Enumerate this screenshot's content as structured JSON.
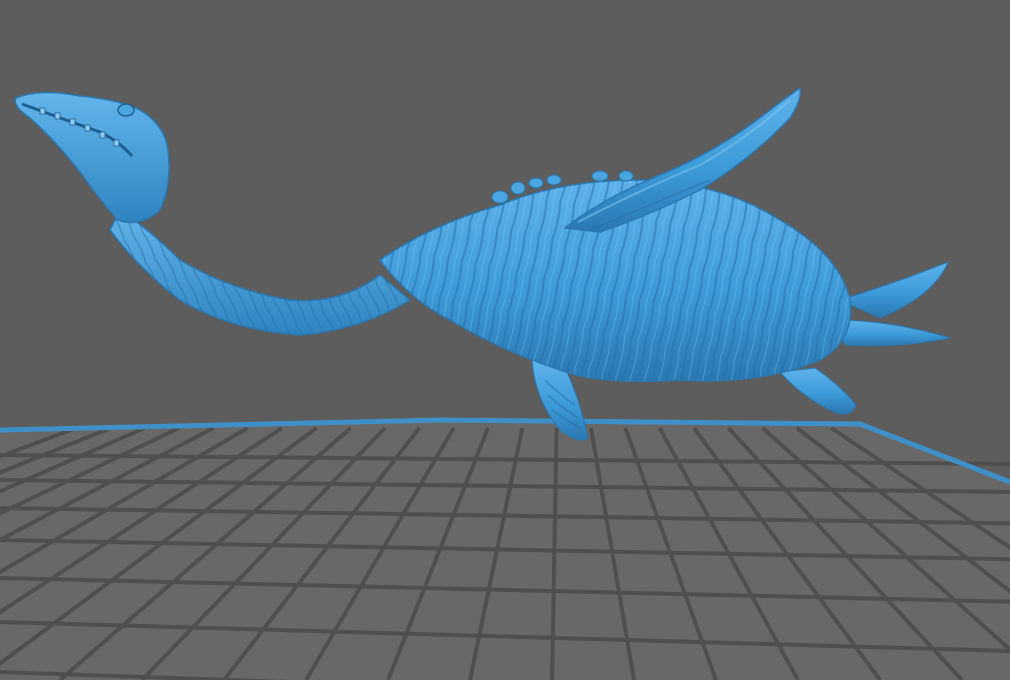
{
  "viewport": {
    "background_color": "#5d5d5d",
    "floor_color": "#686868",
    "grid_line_color": "#4f4f4f",
    "plate_border_color": "#3f8fc8",
    "model_color": "#3e9bd8",
    "model_shadow_color": "#2a78b2",
    "model_highlight_color": "#7cc4f0"
  },
  "model": {
    "kind": "plesiosaur-sculpture"
  }
}
